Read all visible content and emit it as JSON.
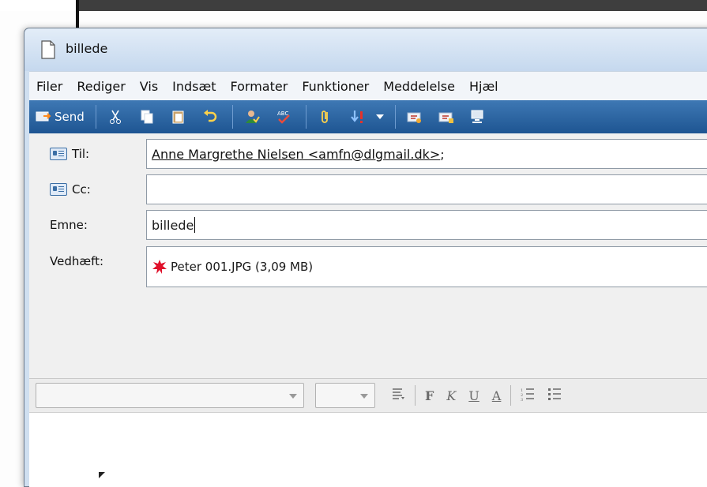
{
  "window": {
    "title": "billede"
  },
  "menu": [
    "Filer",
    "Rediger",
    "Vis",
    "Indsæt",
    "Formater",
    "Funktioner",
    "Meddelelse",
    "Hjæl"
  ],
  "toolbar": {
    "send_label": "Send",
    "icons": [
      "send-icon",
      "cut-icon",
      "copy-icon",
      "paste-icon",
      "undo-icon",
      "check-names-icon",
      "spelling-icon",
      "attach-icon",
      "priority-icon",
      "priority-dropdown-icon",
      "sign-icon",
      "encrypt-icon",
      "offline-icon"
    ]
  },
  "fields": {
    "to_label": "Til:",
    "to_value": "Anne Margrethe Nielsen <amfn@dlgmail.dk>",
    "to_suffix": ";",
    "cc_label": "Cc:",
    "cc_value": "",
    "subject_label": "Emne:",
    "subject_value": "billede",
    "attach_label": "Vedhæft:",
    "attach_value": "Peter 001.JPG (3,09 MB)"
  },
  "format_bar": {
    "font_name": "",
    "font_size": "",
    "buttons": [
      "F",
      "K",
      "U",
      "A"
    ]
  },
  "colors": {
    "toolbar": "#1e5592",
    "titlebar": "#c5d8ee",
    "attachment_icon": "#e0102a"
  }
}
